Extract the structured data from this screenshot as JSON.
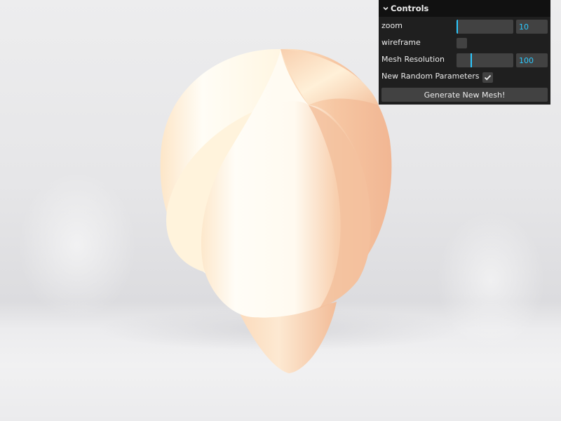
{
  "gui": {
    "title": "Controls",
    "title_icon": "chevron-down-icon",
    "zoom": {
      "label": "zoom",
      "value": "10",
      "fraction": 0.0
    },
    "wireframe": {
      "label": "wireframe",
      "checked": false
    },
    "mesh_resolution": {
      "label": "Mesh Resolution",
      "value": "100",
      "fraction": 0.25
    },
    "new_random_parameters": {
      "label": "New Random Parameters",
      "checked": true
    },
    "generate_button": {
      "label": "Generate New Mesh!"
    }
  },
  "colors": {
    "accent": "#2cc9ff",
    "panel_bg": "#1f1f1f",
    "widget_bg": "#424242",
    "mesh_light": "#fffaf0",
    "mesh_shadow": "#f2b995"
  }
}
